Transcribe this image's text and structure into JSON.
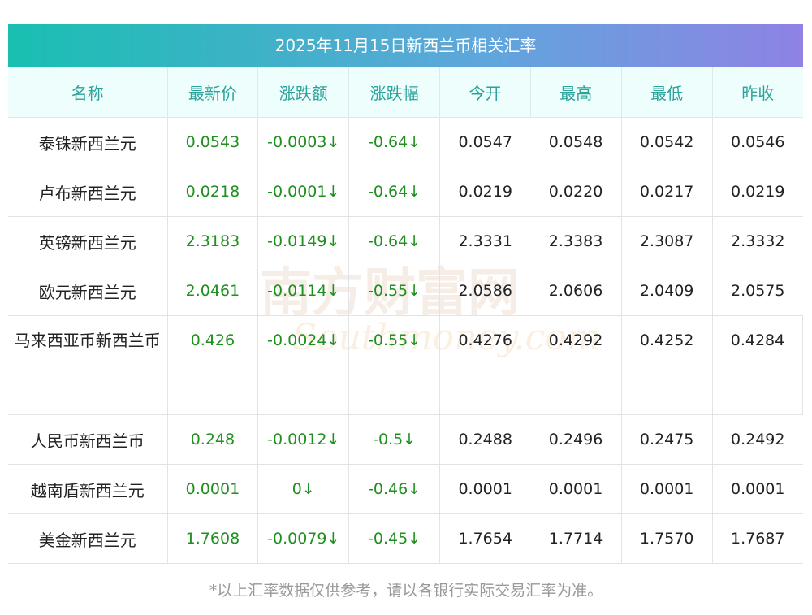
{
  "title": "2025年11月15日新西兰币相关汇率",
  "headers": [
    "名称",
    "最新价",
    "涨跌额",
    "涨跌幅",
    "今开",
    "最高",
    "最低",
    "昨收"
  ],
  "rows": [
    {
      "name": "泰铢新西兰元",
      "latest": "0.0543",
      "change": "-0.0003↓",
      "pct": "-0.64↓",
      "open": "0.0547",
      "high": "0.0548",
      "low": "0.0542",
      "prev": "0.0546"
    },
    {
      "name": "卢布新西兰元",
      "latest": "0.0218",
      "change": "-0.0001↓",
      "pct": "-0.64↓",
      "open": "0.0219",
      "high": "0.0220",
      "low": "0.0217",
      "prev": "0.0219"
    },
    {
      "name": "英镑新西兰元",
      "latest": "2.3183",
      "change": "-0.0149↓",
      "pct": "-0.64↓",
      "open": "2.3331",
      "high": "2.3383",
      "low": "2.3087",
      "prev": "2.3332"
    },
    {
      "name": "欧元新西兰元",
      "latest": "2.0461",
      "change": "-0.0114↓",
      "pct": "-0.55↓",
      "open": "2.0586",
      "high": "2.0606",
      "low": "2.0409",
      "prev": "2.0575"
    },
    {
      "name": "马来西亚币新西兰币",
      "latest": "0.426",
      "change": "-0.0024↓",
      "pct": "-0.55↓",
      "open": "0.4276",
      "high": "0.4292",
      "low": "0.4252",
      "prev": "0.4284"
    },
    {
      "name": "人民币新西兰币",
      "latest": "0.248",
      "change": "-0.0012↓",
      "pct": "-0.5↓",
      "open": "0.2488",
      "high": "0.2496",
      "low": "0.2475",
      "prev": "0.2492"
    },
    {
      "name": "越南盾新西兰元",
      "latest": "0.0001",
      "change": "0↓",
      "pct": "-0.46↓",
      "open": "0.0001",
      "high": "0.0001",
      "low": "0.0001",
      "prev": "0.0001"
    },
    {
      "name": "美金新西兰元",
      "latest": "1.7608",
      "change": "-0.0079↓",
      "pct": "-0.45↓",
      "open": "1.7654",
      "high": "1.7714",
      "low": "1.7570",
      "prev": "1.7687"
    }
  ],
  "watermark": {
    "cn": "南方财富网",
    "en": "Southmoney.com"
  },
  "footnote": "*以上汇率数据仅供参考，请以各银行实际交易汇率为准。",
  "colors": {
    "header_text": "#2aa39a",
    "header_bg": "#eefefd",
    "down": "#1f8f1f",
    "gradient_start": "#19bfb1",
    "gradient_end": "#8f82e4"
  }
}
